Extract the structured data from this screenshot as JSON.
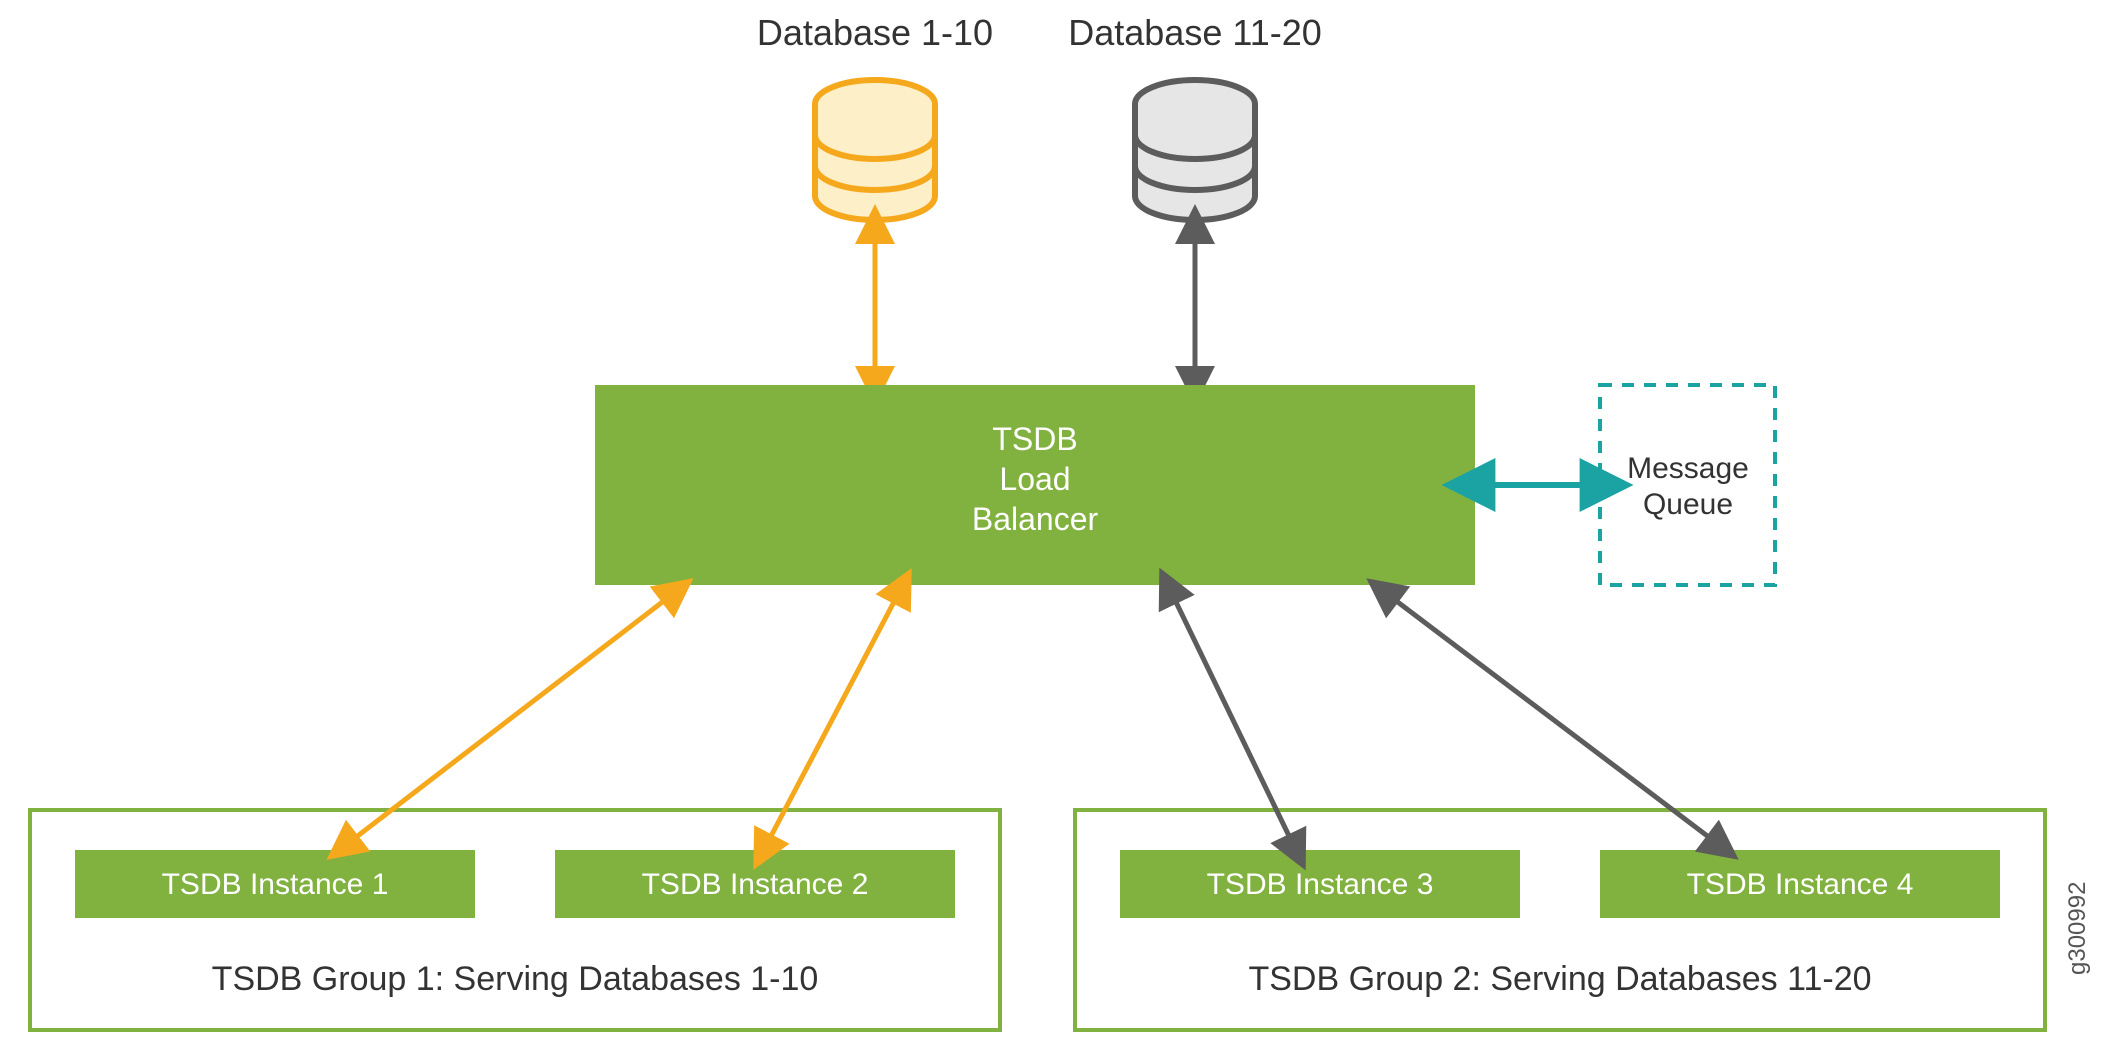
{
  "colors": {
    "green": "#81b13f",
    "greenStroke": "#6fa02e",
    "orange": "#f6a81c",
    "gray": "#5c5c5c",
    "teal": "#1ba3a3",
    "dbYellowFill": "#fdf0c8",
    "dbYellowStroke": "#f6a81c",
    "dbGrayFill": "#e6e6e6",
    "dbGrayStroke": "#5c5c5c",
    "textDark": "#333"
  },
  "databases": {
    "left": {
      "label": "Database 1-10"
    },
    "right": {
      "label": "Database 11-20"
    }
  },
  "loadBalancer": {
    "line1": "TSDB",
    "line2": "Load",
    "line3": "Balancer"
  },
  "messageQueue": {
    "line1": "Message",
    "line2": "Queue"
  },
  "groups": {
    "1": {
      "label": "TSDB Group 1: Serving Databases 1-10",
      "instances": [
        "TSDB Instance 1",
        "TSDB Instance 2"
      ]
    },
    "2": {
      "label": "TSDB Group 2: Serving Databases 11-20",
      "instances": [
        "TSDB Instance 3",
        "TSDB Instance 4"
      ]
    }
  },
  "figureId": "g300992"
}
